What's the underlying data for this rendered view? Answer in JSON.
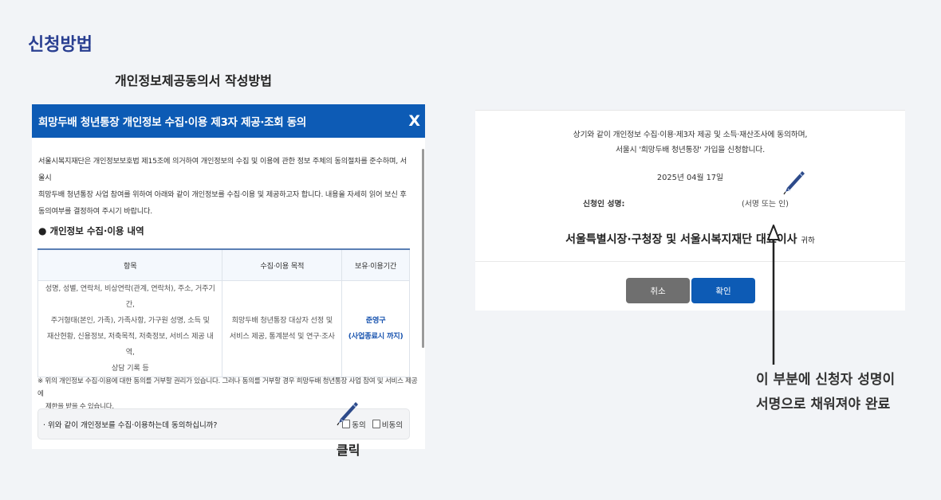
{
  "page": {
    "title": "신청방법",
    "subtitle": "개인정보제공동의서 작성방법"
  },
  "modal": {
    "title": "희망두배 청년통장 개인정보 수집·이용 제3자 제공·조회 동의",
    "close_label": "X",
    "intro_lines": [
      "서울시복지재단은 개인정보보호법 제15조에 의거하여 개인정보의 수집 및 이용에 관한 정보 주체의 동의절차를 준수하며, 서울시",
      "희망두배 청년통장 사업 참여를 위하여 아래와 같이 개인정보를 수집·이용 및 제공하고자 합니다. 내용을 자세히 읽어 보신 후",
      "동의여부를 결정하여 주시기 바랍니다."
    ],
    "section_title": "개인정보 수집·이용 내역",
    "section_bullet": "●",
    "table": {
      "headers": [
        "항목",
        "수집·이용 목적",
        "보유·이용기간"
      ],
      "items_lines": [
        "성명, 성별, 연락처, 비상연락(관계, 연락처), 주소, 거주기간,",
        "주거형태(본인, 가족), 가족사항, 가구원 성명, 소득 및",
        "재산현황, 신용정보, 저축목적, 저축정보, 서비스 제공 내역,",
        "상담 기록 등"
      ],
      "purpose_lines": [
        "희망두배 청년통장 대상자 선정 및",
        "서비스 제공, 통계분석 및 연구·조사"
      ],
      "period_lines": [
        "준영구",
        "(사업종료시 까지)"
      ]
    },
    "note_lines": [
      "※ 위의 개인정보 수집·이용에 대한 동의를 거부할 권리가 있습니다. 그러나 동의를 거부할 경우 희망두배 청년통장 사업 참여 및 서비스 제공에",
      "제한을 받을 수 있습니다."
    ],
    "agree_question": "· 위와 같이 개인정보를 수집·이용하는데 동의하십니까?",
    "agree_label": "동의",
    "disagree_label": "비동의"
  },
  "click_label": "클릭",
  "panel": {
    "line1": "상기와 같이 개인정보 수집·이용·제3자 제공 및 소득·재산조사에 동의하며,",
    "line2": "서울시 '희망두배 청년통장' 가입을 신청합니다.",
    "date": "2025년 04월 17일",
    "signer_label": "신청인 성명:",
    "signer_hint": "(서명 또는 인)",
    "recipient": "서울특별시장·구청장 및 서울시복지재단 대표이사",
    "recipient_suffix": "귀하",
    "cancel_label": "취소",
    "confirm_label": "확인"
  },
  "caption_lines": [
    "이 부분에 신청자 성명이",
    "서명으로 채워져야 완료"
  ],
  "colors": {
    "brand_blue": "#0d5bb5",
    "title_navy": "#2a3f91",
    "cancel_gray": "#6f6f6f",
    "background": "#f2f4f7"
  },
  "icons": [
    "pen-icon",
    "arrow-up-icon",
    "close-icon"
  ]
}
